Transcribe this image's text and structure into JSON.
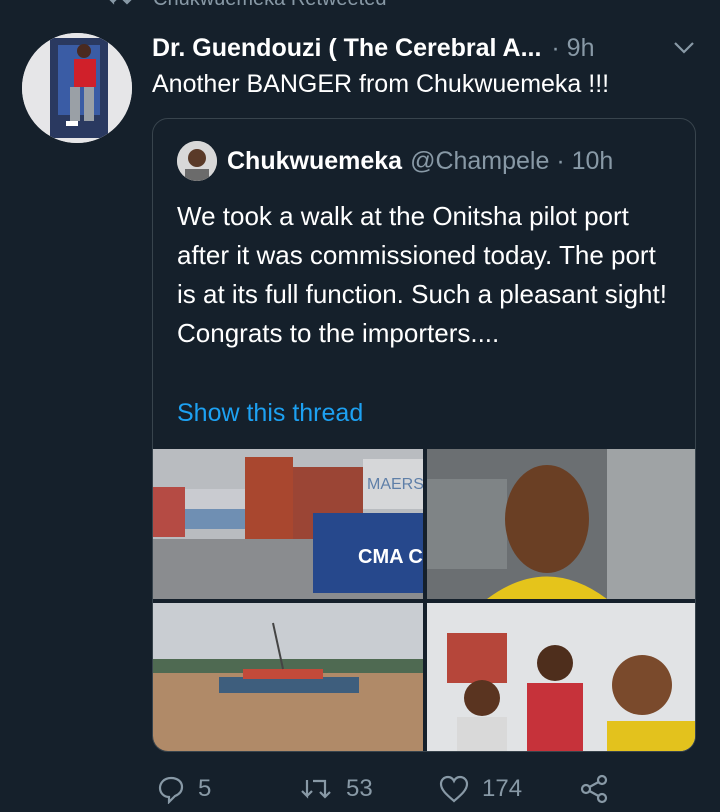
{
  "retweet": {
    "text": "Chukwuemeka Retweeted",
    "icon": "retweet-icon"
  },
  "tweet": {
    "author_name": "Dr. Guendouzi ( The Cerebral A...",
    "meta": "· 9h",
    "text": "Another BANGER from Chukwuemeka !!!"
  },
  "quote": {
    "name": "Chukwuemeka",
    "handle": "@Champele · 10h",
    "text": "We took a walk at the Onitsha pilot port after it was commissioned today. The port is at its full function. Such a pleasant sight! Congrats to the importers....",
    "show_thread": "Show this thread",
    "photo_text": {
      "maersk": "MAERSK",
      "cma": "CMA C"
    }
  },
  "actions": {
    "reply_count": "5",
    "retweet_count": "53",
    "like_count": "174"
  },
  "colors": {
    "background": "#15202b",
    "muted": "#8899a6",
    "link": "#1da1f2",
    "border": "#38444d"
  }
}
